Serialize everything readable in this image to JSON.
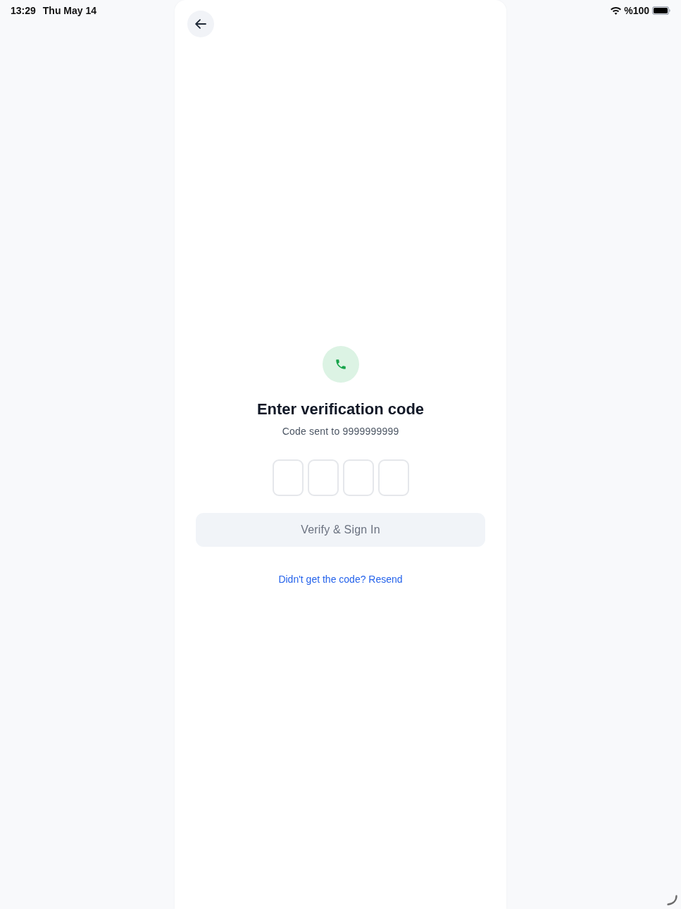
{
  "status_bar": {
    "time": "13:29",
    "date": "Thu May 14",
    "battery": "%100"
  },
  "verification": {
    "title": "Enter verification code",
    "subtitle": "Code sent to 9999999999"
  },
  "code_boxes": [
    {
      "focused": false
    },
    {
      "focused": false
    },
    {
      "focused": false
    },
    {
      "focused": false
    }
  ],
  "verify_button": {
    "label": "Verify & Sign In",
    "disabled": true
  },
  "resend_link": "Didn't get the code? Resend"
}
